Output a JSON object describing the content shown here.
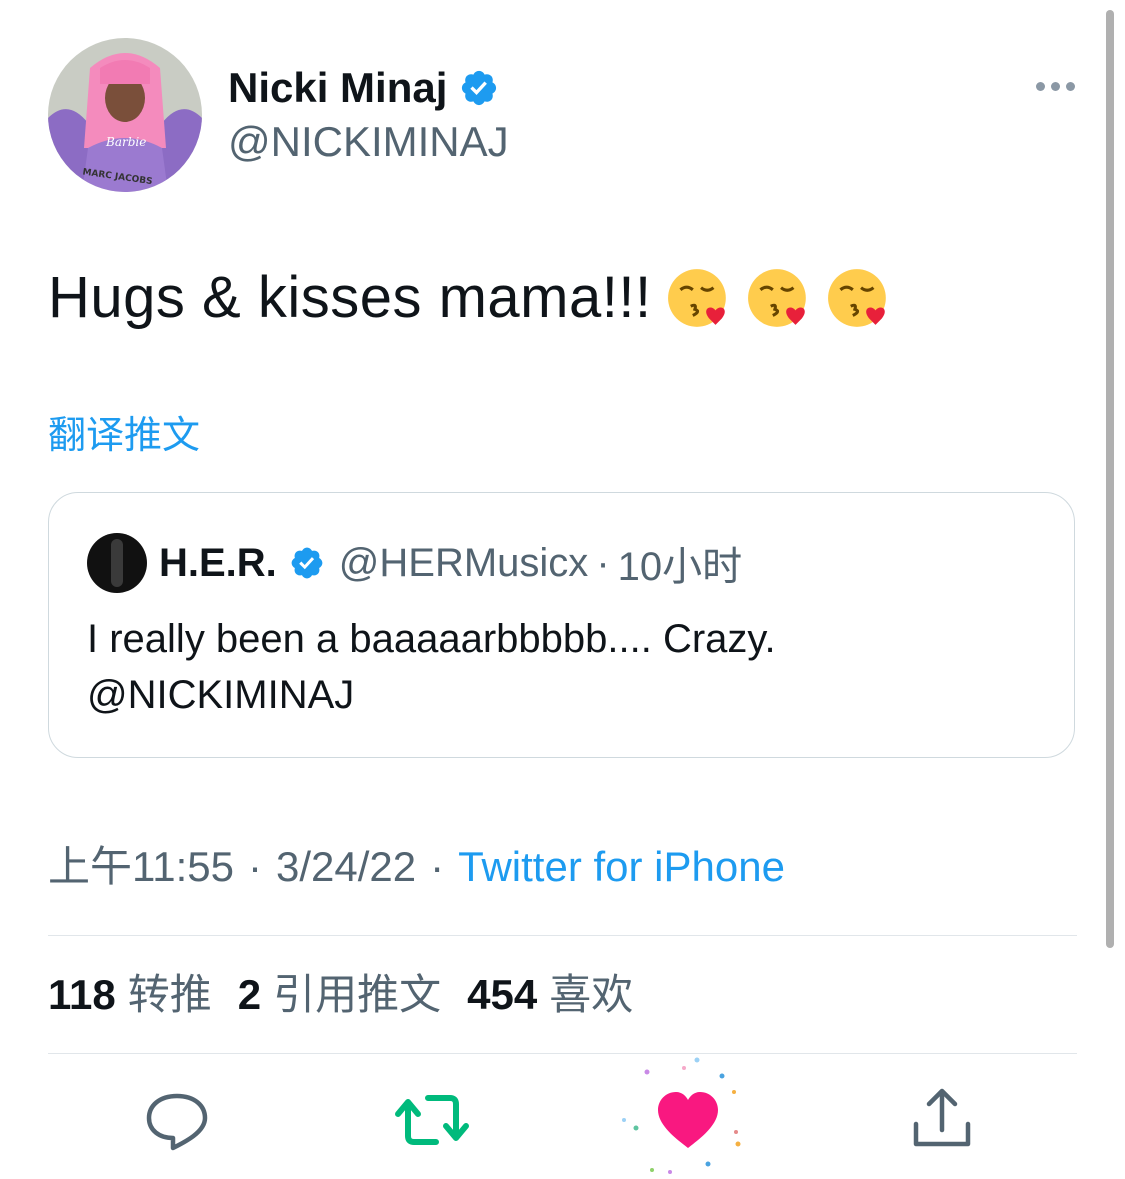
{
  "author": {
    "name": "Nicki Minaj",
    "handle": "@NICKIMINAJ",
    "avatar_text": "Barbie MARC JACOBS"
  },
  "tweet": {
    "text": "Hugs & kisses mama!!!",
    "emoji": [
      "kissing-face-with-heart",
      "kissing-face-with-heart",
      "kissing-face-with-heart"
    ],
    "translate_label": "翻译推文"
  },
  "quoted": {
    "name": "H.E.R.",
    "handle": "@HERMusicx",
    "separator": "·",
    "time": "10小时",
    "text": "I really been a baaaaarbbbbb.... Crazy. @NICKIMINAJ"
  },
  "meta": {
    "time": "上午11:55",
    "date": "3/24/22",
    "separator": "·",
    "source": "Twitter for iPhone"
  },
  "stats": {
    "retweets_count": "118",
    "retweets_label": "转推",
    "quotes_count": "2",
    "quotes_label": "引用推文",
    "likes_count": "454",
    "likes_label": "喜欢"
  },
  "actions": {
    "liked": true,
    "icons": [
      "reply-icon",
      "retweet-icon",
      "like-icon",
      "share-icon"
    ]
  },
  "colors": {
    "accent": "#1d9bf0",
    "retweet": "#00ba7c",
    "like": "#f91880",
    "secondary_text": "#536471"
  }
}
